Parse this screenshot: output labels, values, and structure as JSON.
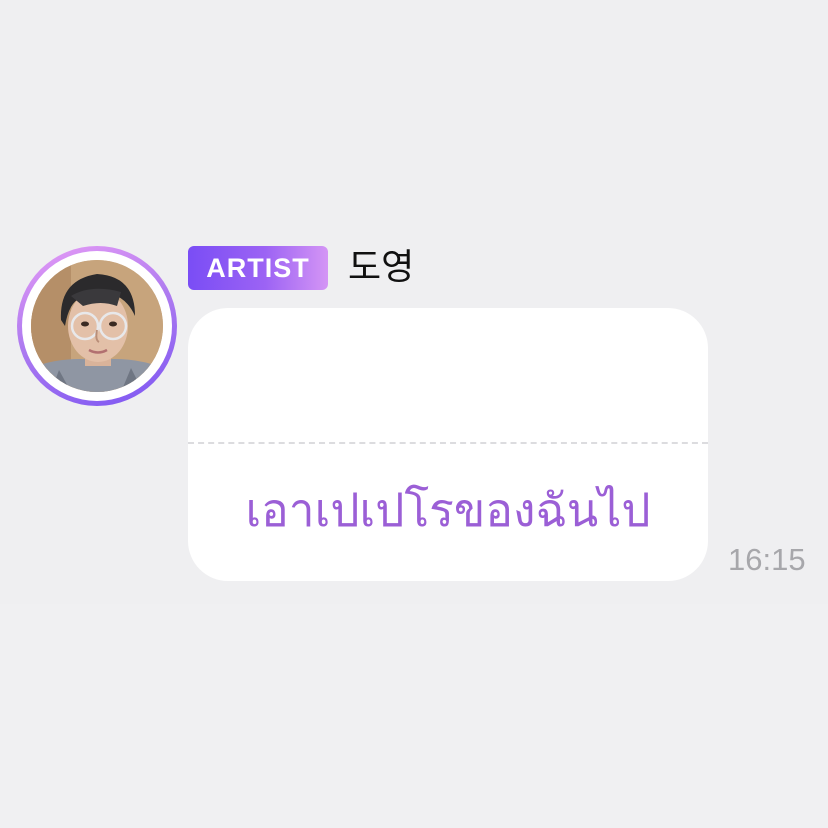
{
  "message": {
    "badge_label": "ARTIST",
    "sender_name": "도영",
    "text": "เอาเปเปโรของฉันไป",
    "time": "16:15"
  },
  "colors": {
    "background": "#efeff1",
    "bubble": "#ffffff",
    "message_text": "#9b5fd6",
    "badge_gradient_start": "#7a4df5",
    "badge_gradient_end": "#d495f5",
    "avatar_ring": "#b07cf0",
    "timestamp": "#a7a7ab"
  },
  "icons": {
    "avatar": "profile-photo"
  }
}
